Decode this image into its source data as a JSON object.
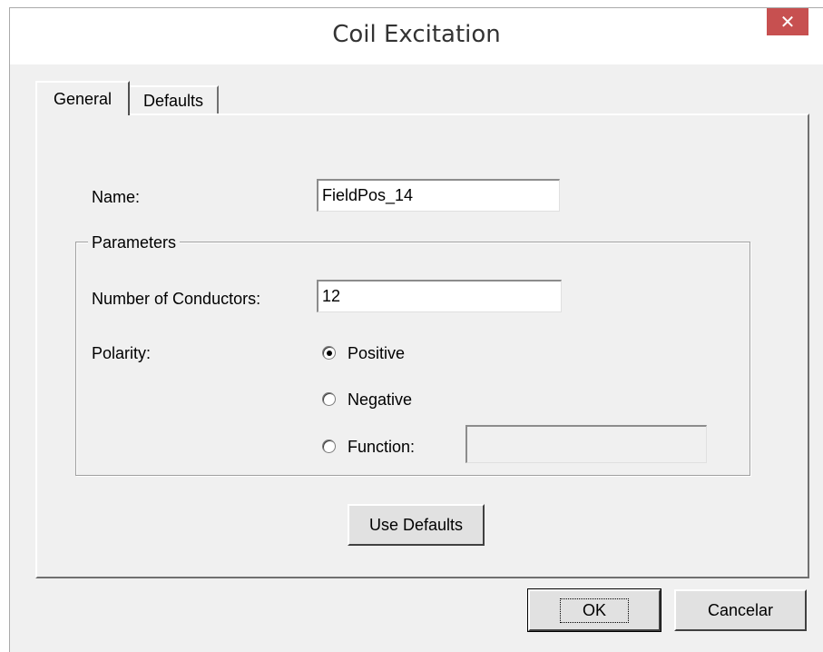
{
  "window": {
    "title": "Coil Excitation",
    "close_glyph": "✕"
  },
  "tabs": [
    {
      "label": "General",
      "active": true
    },
    {
      "label": "Defaults",
      "active": false
    }
  ],
  "form": {
    "name_label": "Name:",
    "name_value": "FieldPos_14",
    "parameters_group": "Parameters",
    "conductors_label": "Number of Conductors:",
    "conductors_value": "12",
    "polarity_label": "Polarity:",
    "polarity_options": [
      {
        "label": "Positive",
        "selected": true
      },
      {
        "label": "Negative",
        "selected": false
      },
      {
        "label": "Function:",
        "selected": false
      }
    ],
    "function_value": ""
  },
  "buttons": {
    "use_defaults": "Use Defaults",
    "ok": "OK",
    "cancel": "Cancelar"
  }
}
